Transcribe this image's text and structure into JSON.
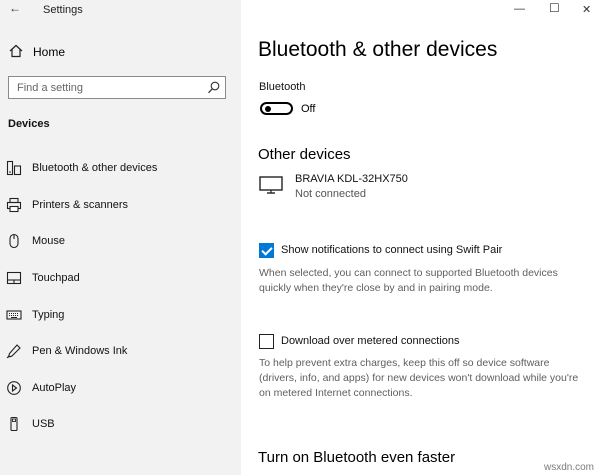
{
  "window": {
    "title": "Settings",
    "minimize": "—",
    "maximize": "☐",
    "close": "✕"
  },
  "sidebar": {
    "home_label": "Home",
    "search_placeholder": "Find a setting",
    "section_title": "Devices",
    "items": [
      {
        "label": "Bluetooth & other devices",
        "icon": "bluetooth-devices-icon"
      },
      {
        "label": "Printers & scanners",
        "icon": "printer-icon"
      },
      {
        "label": "Mouse",
        "icon": "mouse-icon"
      },
      {
        "label": "Touchpad",
        "icon": "touchpad-icon"
      },
      {
        "label": "Typing",
        "icon": "keyboard-icon"
      },
      {
        "label": "Pen & Windows Ink",
        "icon": "pen-icon"
      },
      {
        "label": "AutoPlay",
        "icon": "autoplay-icon"
      },
      {
        "label": "USB",
        "icon": "usb-icon"
      }
    ]
  },
  "main": {
    "page_title": "Bluetooth & other devices",
    "bluetooth_label": "Bluetooth",
    "bluetooth_state": "Off",
    "other_devices_heading": "Other devices",
    "device": {
      "name": "BRAVIA KDL-32HX750",
      "status": "Not connected",
      "icon": "tv-icon"
    },
    "swift_pair": {
      "label": "Show notifications to connect using Swift Pair",
      "checked": true,
      "desc_lines": [
        "When selected, you can connect to supported Bluetooth devices",
        "quickly when they're close by and in pairing mode."
      ]
    },
    "metered": {
      "label": "Download over metered connections",
      "checked": false,
      "desc_lines": [
        "To help prevent extra charges, keep this off so device software",
        "(drivers, info, and apps) for new devices won't download while you're",
        "on metered Internet connections."
      ]
    },
    "faster_heading": "Turn on Bluetooth even faster"
  },
  "watermark": "wsxdn.com",
  "colors": {
    "accent": "#0078d7",
    "sidebar_bg": "#f2f2f2"
  }
}
